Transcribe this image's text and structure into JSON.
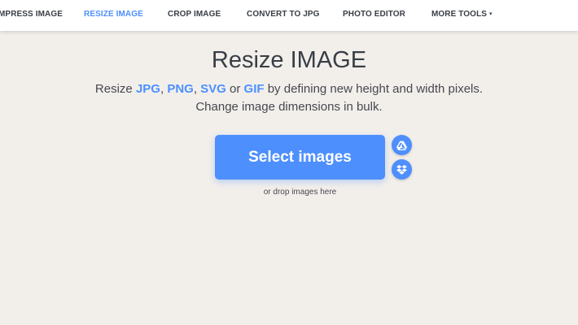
{
  "nav": {
    "items": [
      {
        "label": "MPRESS IMAGE",
        "active": false
      },
      {
        "label": "RESIZE IMAGE",
        "active": true
      },
      {
        "label": "CROP IMAGE",
        "active": false
      },
      {
        "label": "CONVERT TO JPG",
        "active": false
      },
      {
        "label": "PHOTO EDITOR",
        "active": false
      },
      {
        "label": "MORE TOOLS",
        "active": false
      }
    ],
    "more_caret": "▾"
  },
  "main": {
    "title": "Resize IMAGE",
    "subtitle_line1": {
      "prefix": "Resize ",
      "formats": [
        "JPG",
        "PNG",
        "SVG",
        "GIF"
      ],
      "sep1": ", ",
      "sep2": ", ",
      "or": " or ",
      "suffix": " by defining new height and width pixels."
    },
    "subtitle_line2": "Change image dimensions in bulk.",
    "select_button": "Select images",
    "drop_hint": "or drop images here",
    "cloud_icons": [
      "google-drive-icon",
      "dropbox-icon"
    ]
  },
  "colors": {
    "accent": "#4d8ffd",
    "background": "#f2efeb",
    "text": "#383e45"
  }
}
